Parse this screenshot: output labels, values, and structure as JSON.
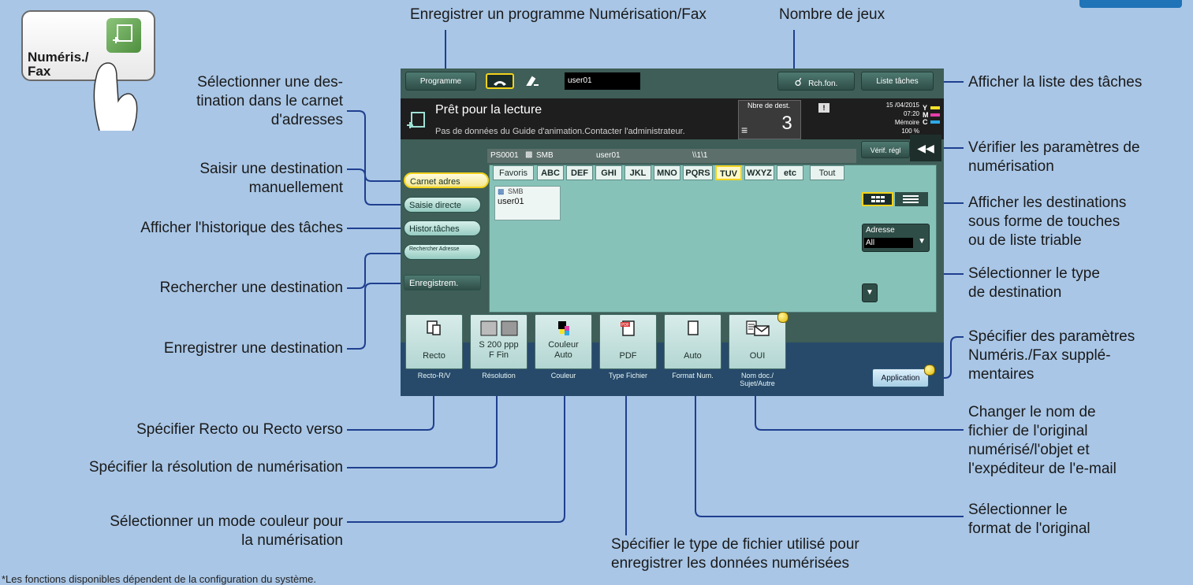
{
  "corner_tab": "",
  "key_icon": {
    "line1": "Numéris./",
    "line2": "Fax"
  },
  "annotations": {
    "register_program": "Enregistrer un programme Numérisation/Fax",
    "num_sets": "Nombre de jeux",
    "job_list": "Afficher la liste des tâches",
    "addr_book": [
      "Sélectionner une des-",
      "tination dans le carnet",
      "d'adresses"
    ],
    "direct_input": [
      "Saisir une destination",
      "manuellement"
    ],
    "job_history": "Afficher l'historique des tâches",
    "search_dest": "Rechercher une destination",
    "register_dest": "Enregistrer une destination",
    "check_settings": [
      "Vérifier les paramètres de",
      "numérisation"
    ],
    "display_mode": [
      "Afficher les destinations",
      "sous forme de touches",
      "ou de liste triable"
    ],
    "dest_type": [
      "Sélectionner le type",
      "de destination"
    ],
    "extra_params": [
      "Spécifier des paramètres",
      "Numéris./Fax supplé-",
      "mentaires"
    ],
    "file_name": [
      "Changer le nom de",
      "fichier de l'original",
      "numérisé/l'objet et",
      "l'expéditeur de l'e-mail"
    ],
    "orig_size": [
      "Sélectionner le",
      "format de l'original"
    ],
    "simplex": "Spécifier Recto ou Recto verso",
    "resolution": "Spécifier la résolution de numérisation",
    "color_mode": [
      "Sélectionner un mode couleur pour",
      "la numérisation"
    ],
    "file_type": [
      "Spécifier le type de fichier utilisé pour",
      "enregistrer les données numérisées"
    ]
  },
  "footnote": "*Les fonctions disponibles dépendent de la configuration du système.",
  "panel": {
    "program_btn": "Programme",
    "user_field": "user01",
    "search_btn": "Rch.fon.",
    "job_list_btn": "Liste tâches",
    "status_title": "Prêt pour la lecture",
    "status_msg": "Pas de données du Guide d'animation.Contacter l'administrateur.",
    "dest_count_label": "Nbre de dest.",
    "dest_count": "3",
    "date": "15 /04/2015",
    "time": "07:20",
    "memory_label": "Mémoire",
    "memory": "100 %",
    "toner": [
      "Y",
      "M",
      "C"
    ],
    "check_btn": "Vérif. régl",
    "dest_bar": {
      "id": "PS0001",
      "type": "SMB",
      "user": "user01",
      "path": "\\\\1\\1"
    },
    "tabs": [
      "Favoris",
      "ABC",
      "DEF",
      "GHI",
      "JKL",
      "MNO",
      "PQRS",
      "TUV",
      "WXYZ",
      "etc",
      "Tout"
    ],
    "side": [
      "Carnet adres",
      "Saisie directe",
      "Histor.tâches",
      "Rechercher Adresse",
      "Enregistrem."
    ],
    "entry": {
      "type": "SMB",
      "name": "user01"
    },
    "address_label": "Adresse",
    "address_value": "All",
    "functions": [
      {
        "value": "Recto",
        "label": "Recto-R/V",
        "icon": "simplex-icon"
      },
      {
        "value": "S 200 ppp\nF Fin",
        "label": "Résolution",
        "icon": "resolution-icon"
      },
      {
        "value": "Couleur\nAuto",
        "label": "Couleur",
        "icon": "color-icon"
      },
      {
        "value": "PDF",
        "label": "Type Fichier",
        "icon": "pdf-icon"
      },
      {
        "value": "Auto",
        "label": "Format Num.",
        "icon": "page-icon"
      },
      {
        "value": "OUI",
        "label": "Nom doc./\nSujet/Autre",
        "icon": "mail-doc-icon"
      }
    ],
    "pdf_badge": "PDF",
    "application_btn": "Application"
  },
  "colors": {
    "background": "#a9c6e6",
    "panel": "#3e5e57",
    "dest_area": "#86c2b8",
    "accent": "#1f73b7",
    "highlight": "#f2d21b"
  }
}
